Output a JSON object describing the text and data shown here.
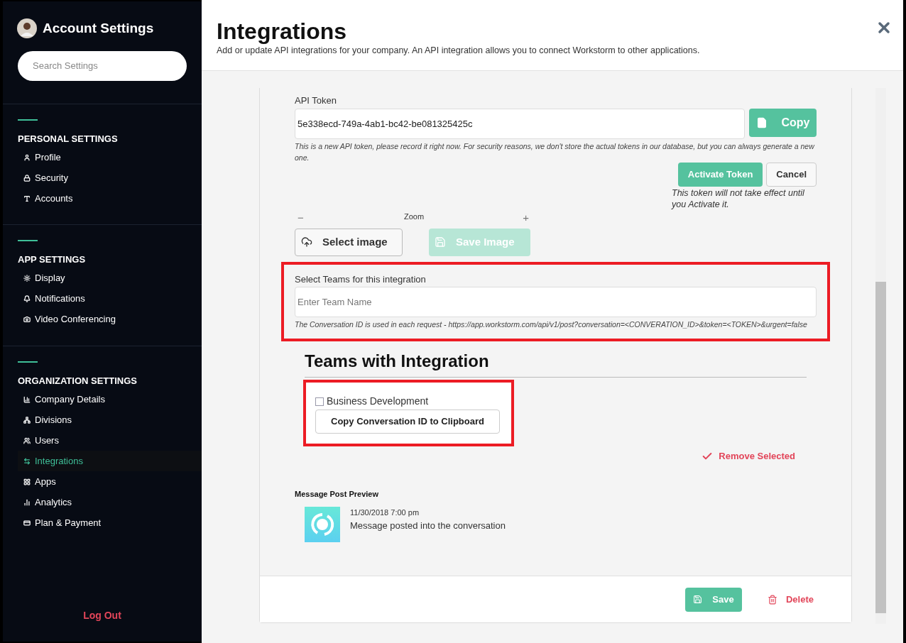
{
  "sidebar": {
    "title": "Account Settings",
    "search": {
      "placeholder": "Search Settings"
    },
    "sections": [
      {
        "title": "PERSONAL SETTINGS",
        "items": [
          {
            "label": "Profile",
            "selected": false
          },
          {
            "label": "Security",
            "selected": false
          },
          {
            "label": "Accounts",
            "selected": false
          }
        ]
      },
      {
        "title": "APP SETTINGS",
        "items": [
          {
            "label": "Display",
            "selected": false
          },
          {
            "label": "Notifications",
            "selected": false
          },
          {
            "label": "Video Conferencing",
            "selected": false
          }
        ]
      },
      {
        "title": "ORGANIZATION SETTINGS",
        "items": [
          {
            "label": "Company Details",
            "selected": false
          },
          {
            "label": "Divisions",
            "selected": false
          },
          {
            "label": "Users",
            "selected": false
          },
          {
            "label": "Integrations",
            "selected": true
          },
          {
            "label": "Apps",
            "selected": false
          },
          {
            "label": "Analytics",
            "selected": false
          },
          {
            "label": "Plan & Payment",
            "selected": false
          }
        ]
      }
    ],
    "logout": "Log Out"
  },
  "header": {
    "title": "Integrations",
    "subtitle": "Add or update API integrations for your company. An API integration allows you to connect Workstorm to other applications."
  },
  "token": {
    "label": "API Token",
    "value": "5e338ecd-749a-4ab1-bc42-be081325425c",
    "copy_button": "Copy",
    "note": "This is a new API token, please record it right now. For security reasons, we don't store the actual tokens in our database, but you can always generate a new one.",
    "activate_button": "Activate Token",
    "cancel_button": "Cancel",
    "activate_note": "This token will not take effect until you Activate it."
  },
  "image": {
    "zoom_minus": "−",
    "zoom_label": "Zoom",
    "zoom_plus": "+",
    "select_button": "Select image",
    "save_button": {
      "label": "Save Image",
      "disabled": true
    }
  },
  "teams": {
    "label": "Select Teams for this integration",
    "placeholder": "Enter Team Name",
    "note": "The Conversation ID is used in each request - https://app.workstorm.com/api/v1/post?conversation=<CONVERATION_ID>&token=<TOKEN>&urgent=false"
  },
  "teams_with_integration": {
    "title": "Teams with Integration",
    "items": [
      {
        "name": "Business Development",
        "checked": false,
        "copy_button": "Copy Conversation ID to Clipboard"
      }
    ],
    "remove_button": "Remove Selected"
  },
  "preview": {
    "title": "Message Post Preview",
    "time": "11/30/2018 7:00 pm",
    "message": "Message posted into the conversation"
  },
  "footer": {
    "save_button": "Save",
    "delete_button": "Delete"
  }
}
